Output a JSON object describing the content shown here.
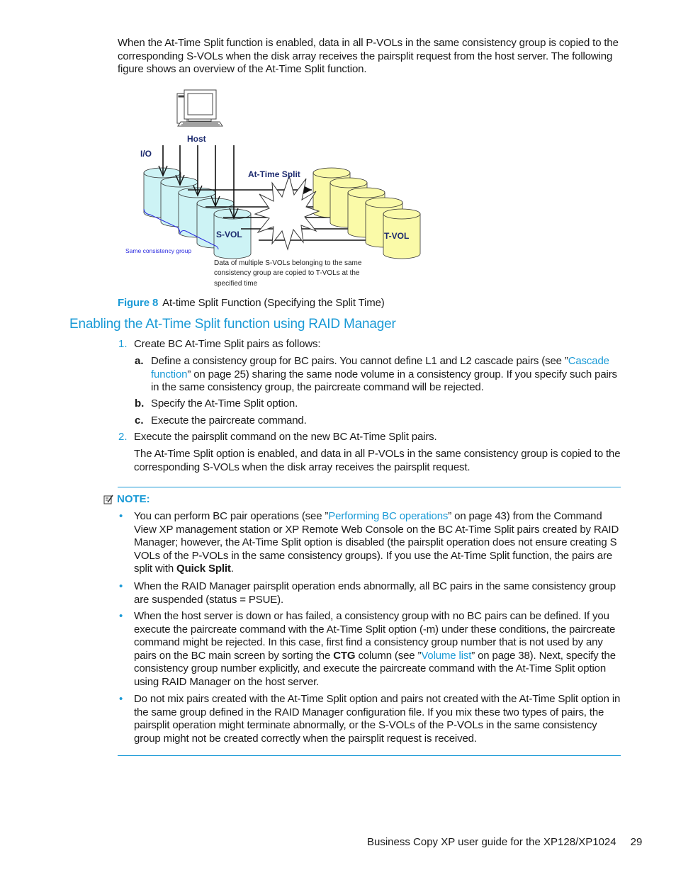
{
  "intro": {
    "text": "When the At-Time Split function is enabled, data in all P-VOLs in the same consistency group is copied to the corresponding S-VOLs when the disk array receives the pairsplit request from the host server. The following figure shows an overview of the At-Time Split function."
  },
  "figure": {
    "host_label": "Host",
    "io_label": "I/O",
    "split_label": "At-Time Split",
    "svol_label": "S-VOL",
    "tvol_label": "T-VOL",
    "group_label": "Same consistency group",
    "note_line1": "Data of multiple S-VOLs belonging to the same",
    "note_line2": "consistency group are copied to T-VOLs at the",
    "note_line3": "specified time",
    "colors": {
      "svol_fill": "#cdf3f5",
      "tvol_fill": "#fafaa8",
      "group_brace": "#2a2adf",
      "label_navy": "#1c2a6e"
    }
  },
  "caption": {
    "label": "Figure 8",
    "text": "At-time Split Function (Specifying the Split Time)"
  },
  "heading": "Enabling the At-Time Split function using RAID Manager",
  "steps": [
    {
      "num": "1.",
      "text": "Create BC At-Time Split pairs as follows:",
      "substeps": [
        {
          "letter": "a.",
          "pre": "Define a consistency group for BC pairs. You cannot define L1 and L2 cascade pairs (see ”",
          "link1": "Cascade",
          "link2": "function",
          "post": "” on page 25) sharing the same node volume in a consistency group. If you specify such pairs in the same consistency group, the paircreate command will be rejected."
        },
        {
          "letter": "b.",
          "text": "Specify the At-Time Split option."
        },
        {
          "letter": "c.",
          "text": "Execute the paircreate command."
        }
      ]
    },
    {
      "num": "2.",
      "text": "Execute the pairsplit command on the new BC At-Time Split pairs.",
      "para": "The At-Time Split option is enabled, and data in all P-VOLs in the same consistency group is copied to the corresponding S-VOLs when the disk array receives the pairsplit request."
    }
  ],
  "note": {
    "title": "NOTE:",
    "bullet_glyph": "•",
    "items": [
      {
        "pre": "You can perform BC pair operations (see ”",
        "link": "Performing BC operations",
        "mid": "” on page 43) from the Command View XP management station or XP Remote Web Console on the BC At-Time Split pairs created by RAID Manager; however, the At-Time Split option is disabled (the pairsplit operation does not ensure creating S VOLs of the P-VOLs in the same consistency groups). If you use the At-Time Split function, the pairs are split with ",
        "bold": "Quick Split",
        "post": "."
      },
      {
        "text": "When the RAID Manager pairsplit operation ends abnormally, all BC pairs in the same consistency group are suspended (status = PSUE)."
      },
      {
        "pre": "When the host server is down or has failed, a consistency group with no BC pairs can be defined. If you execute the paircreate command with the At-Time Split option (-m) under these conditions, the paircreate command might be rejected. In this case, first find a consistency group number that is not used by any pairs on the BC main screen by sorting the ",
        "bold": "CTG",
        "mid": " column (see ”",
        "link": "Volume list",
        "post": "” on page 38). Next, specify the consistency group number explicitly, and execute the paircreate command with the At-Time Split option using RAID Manager on the host server."
      },
      {
        "text": "Do not mix pairs created with the At-Time Split option and pairs not created with the At-Time Split option in the same group defined in the RAID Manager configuration file. If you mix these two types of pairs, the pairsplit operation might terminate abnormally, or the S-VOLs of the P-VOLs in the same consistency group might not be created correctly when the pairsplit request is received."
      }
    ]
  },
  "footer": {
    "title": "Business Copy XP user guide for the XP128/XP1024",
    "page": "29"
  }
}
